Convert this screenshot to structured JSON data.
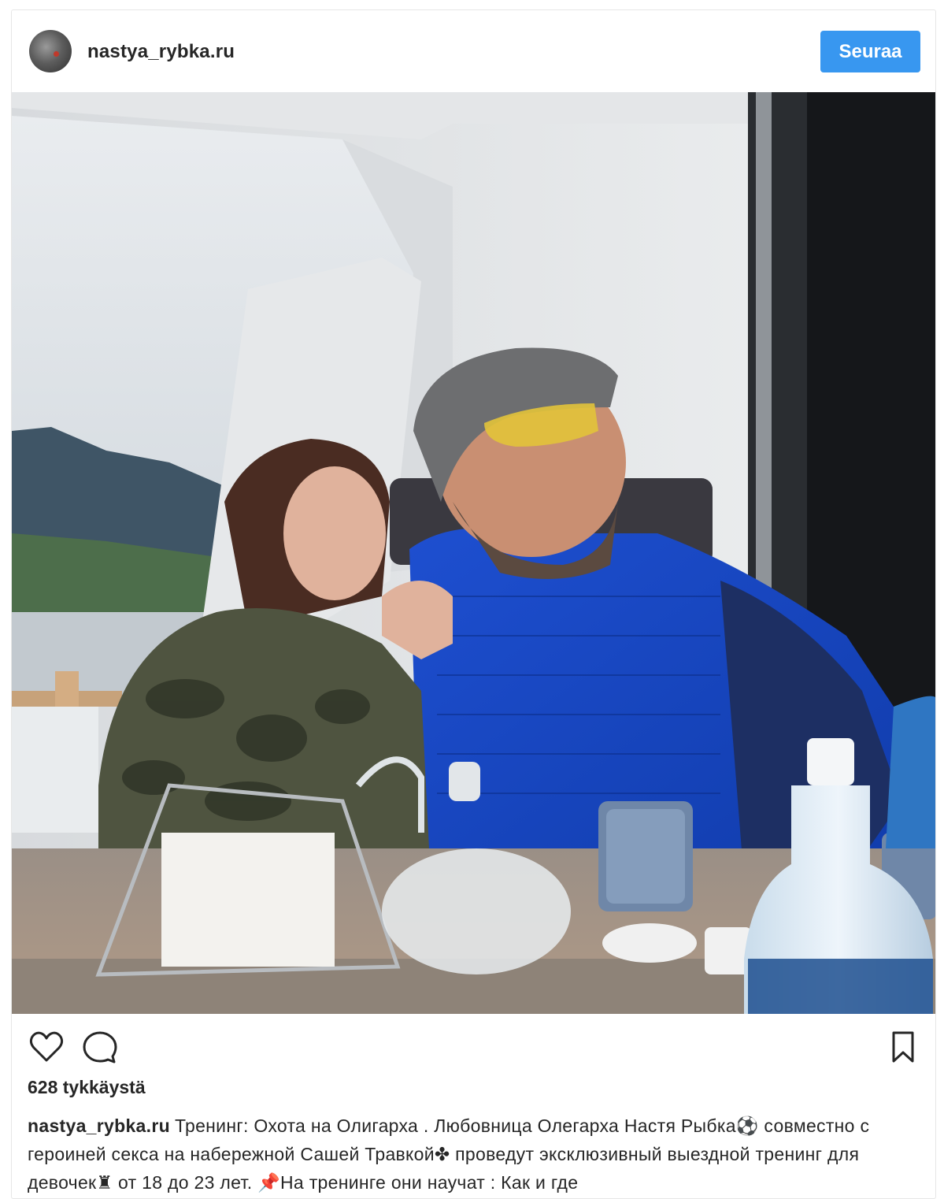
{
  "post": {
    "username": "nastya_rybka.ru",
    "follow_label": "Seuraa",
    "likes": "628 tykkäystä",
    "caption_author": "nastya_rybka.ru",
    "caption_text": "Тренинг: Охота на Олигарха . Любовница Олегарха Настя Рыбка⚽ совместно с героиней секса на набережной Сашей Травкой✤ проведут эксклюзивный выездной тренинг для девочек♜ от 18 до 23 лет. 📌На тренинге они научат : Как и где"
  },
  "icons": {
    "avatar": "avatar",
    "like": "heart-icon",
    "comment": "comment-icon",
    "save": "bookmark-icon"
  },
  "colors": {
    "follow_button": "#3897f0",
    "text": "#262626",
    "border": "#e6e6e6"
  }
}
